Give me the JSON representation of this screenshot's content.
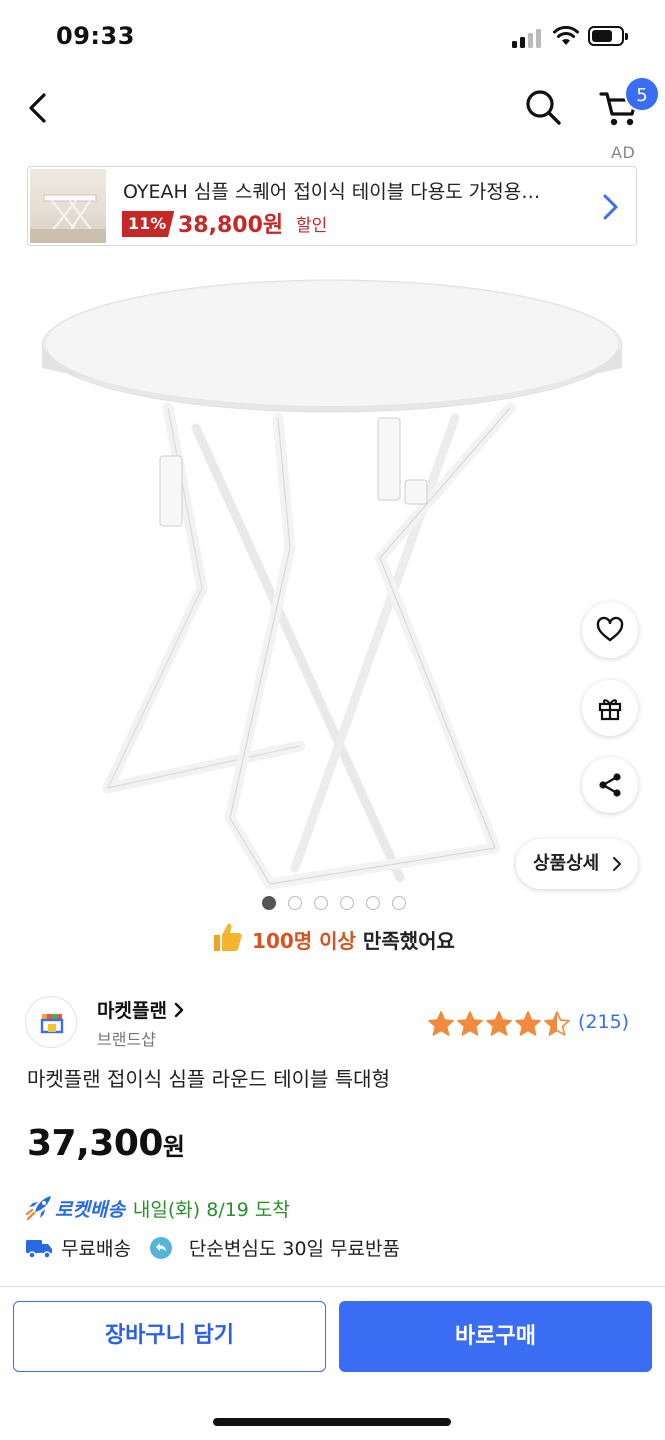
{
  "status_bar": {
    "time": "09:33"
  },
  "nav": {
    "cart_count": "5"
  },
  "ad": {
    "label": "AD",
    "title": "OYEAH 심플 스퀘어 접이식 테이블 다용도 가정용…",
    "discount": "11%",
    "price": "38,800원",
    "sale_label": "할인"
  },
  "gallery": {
    "image_count": 6,
    "active_index": 0
  },
  "detail_button": {
    "label": "상품상세"
  },
  "satisfaction": {
    "highlight": "100명 이상",
    "text": " 만족했어요"
  },
  "seller": {
    "name": "마켓플랜",
    "type": "브랜드샵"
  },
  "rating": {
    "stars": 4.5,
    "review_count": "(215)"
  },
  "product": {
    "title": "마켓플랜 접이식 심플 라운드 테이블 특대형",
    "price": "37,300",
    "currency": "원"
  },
  "delivery": {
    "rocket_label": "로켓배송",
    "arrival": "내일(화) 8/19 도착",
    "free_shipping": "무료배송",
    "return_policy": "단순변심도 30일 무료반품"
  },
  "actions": {
    "cart_button": "장바구니 담기",
    "buy_button": "바로구매"
  },
  "colors": {
    "accent": "#3a6cf4",
    "sale_red": "#c62828",
    "rocket_green": "#2a8f2a",
    "star": "#f08a3c"
  }
}
